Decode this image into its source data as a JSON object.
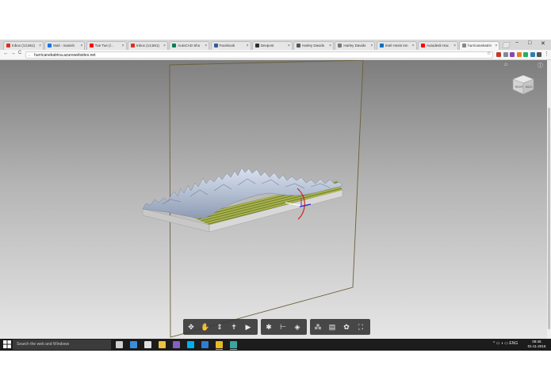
{
  "browser": {
    "tabs": [
      {
        "title": "Inbox (13,561)",
        "favicon_color": "#d93025",
        "active": false
      },
      {
        "title": "Mail - manish",
        "favicon_color": "#1a73e8",
        "active": false
      },
      {
        "title": "Tue Tue (/...",
        "favicon_color": "#ff0000",
        "active": false
      },
      {
        "title": "Inbox (13,561)",
        "favicon_color": "#d93025",
        "active": false
      },
      {
        "title": "AutoCAD Sho",
        "favicon_color": "#0c7c5c",
        "active": false
      },
      {
        "title": "Facebook",
        "favicon_color": "#3b5998",
        "active": false
      },
      {
        "title": "Devpost",
        "favicon_color": "#2e2e2e",
        "active": false
      },
      {
        "title": "Harley Davids",
        "favicon_color": "#555555",
        "active": false
      },
      {
        "title": "Harley Davids",
        "favicon_color": "#777777",
        "active": false
      },
      {
        "title": "Intel Hosts Inn",
        "favicon_color": "#0071c5",
        "active": false
      },
      {
        "title": "Autodesk Hac",
        "favicon_color": "#ff0000",
        "active": false
      },
      {
        "title": "hurricanekatrin",
        "favicon_color": "#888888",
        "active": true
      }
    ],
    "tab_close_glyph": "×",
    "window_controls": {
      "minimize": "−",
      "maximize": "□",
      "close": "✕"
    },
    "nav": {
      "back": "←",
      "forward": "→",
      "reload": "C"
    },
    "url": "hurricanekatrina.azurewebsites.net",
    "url_icon": "page-icon",
    "star": "☆",
    "menu": "⋮",
    "extensions": [
      "#c0392b",
      "#7f8c8d",
      "#8e44ad",
      "#e67e22",
      "#27ae60",
      "#2980b9",
      "#555555"
    ]
  },
  "viewer": {
    "home_glyph": "⌂",
    "info_glyph": "ⓘ",
    "viewcube": {
      "face_left": "RIGHT",
      "face_right": "BACK"
    },
    "toolbar_groups": [
      {
        "tools": [
          {
            "name": "orbit-icon",
            "glyph": "✥"
          },
          {
            "name": "pan-icon",
            "glyph": "✋"
          },
          {
            "name": "zoom-icon",
            "glyph": "⇕"
          },
          {
            "name": "first-person-icon",
            "glyph": "✝"
          },
          {
            "name": "camera-icon",
            "glyph": "▶"
          }
        ]
      },
      {
        "tools": [
          {
            "name": "explode-icon",
            "glyph": "✱"
          },
          {
            "name": "measure-icon",
            "glyph": "⊢"
          },
          {
            "name": "section-icon",
            "glyph": "◈"
          }
        ]
      },
      {
        "tools": [
          {
            "name": "model-browser-icon",
            "glyph": "⁂"
          },
          {
            "name": "properties-icon",
            "glyph": "▤"
          },
          {
            "name": "settings-icon",
            "glyph": "✿"
          },
          {
            "name": "fullscreen-icon",
            "glyph": "⛶"
          }
        ]
      }
    ]
  },
  "taskbar": {
    "start_icon": "windows-logo-icon",
    "search_placeholder": "Search the web and Windows",
    "pinned": [
      {
        "name": "task-view-icon",
        "color": "#cfcfcf"
      },
      {
        "name": "edge-icon",
        "color": "#3b8fd9"
      },
      {
        "name": "store-icon",
        "color": "#e0e0e0"
      },
      {
        "name": "file-explorer-icon",
        "color": "#f0c040"
      },
      {
        "name": "visual-studio-icon",
        "color": "#865fc5"
      },
      {
        "name": "skype-icon",
        "color": "#00aff0"
      },
      {
        "name": "app-blue-icon",
        "color": "#2d7dd2"
      },
      {
        "name": "chrome-icon",
        "color": "#e8b923"
      },
      {
        "name": "app-teal-icon",
        "color": "#3aa5a0"
      }
    ],
    "tray_glyphs": "^ ▭ ◖ ▭ ENG",
    "time": "08:45",
    "date": "01-11-2016"
  }
}
